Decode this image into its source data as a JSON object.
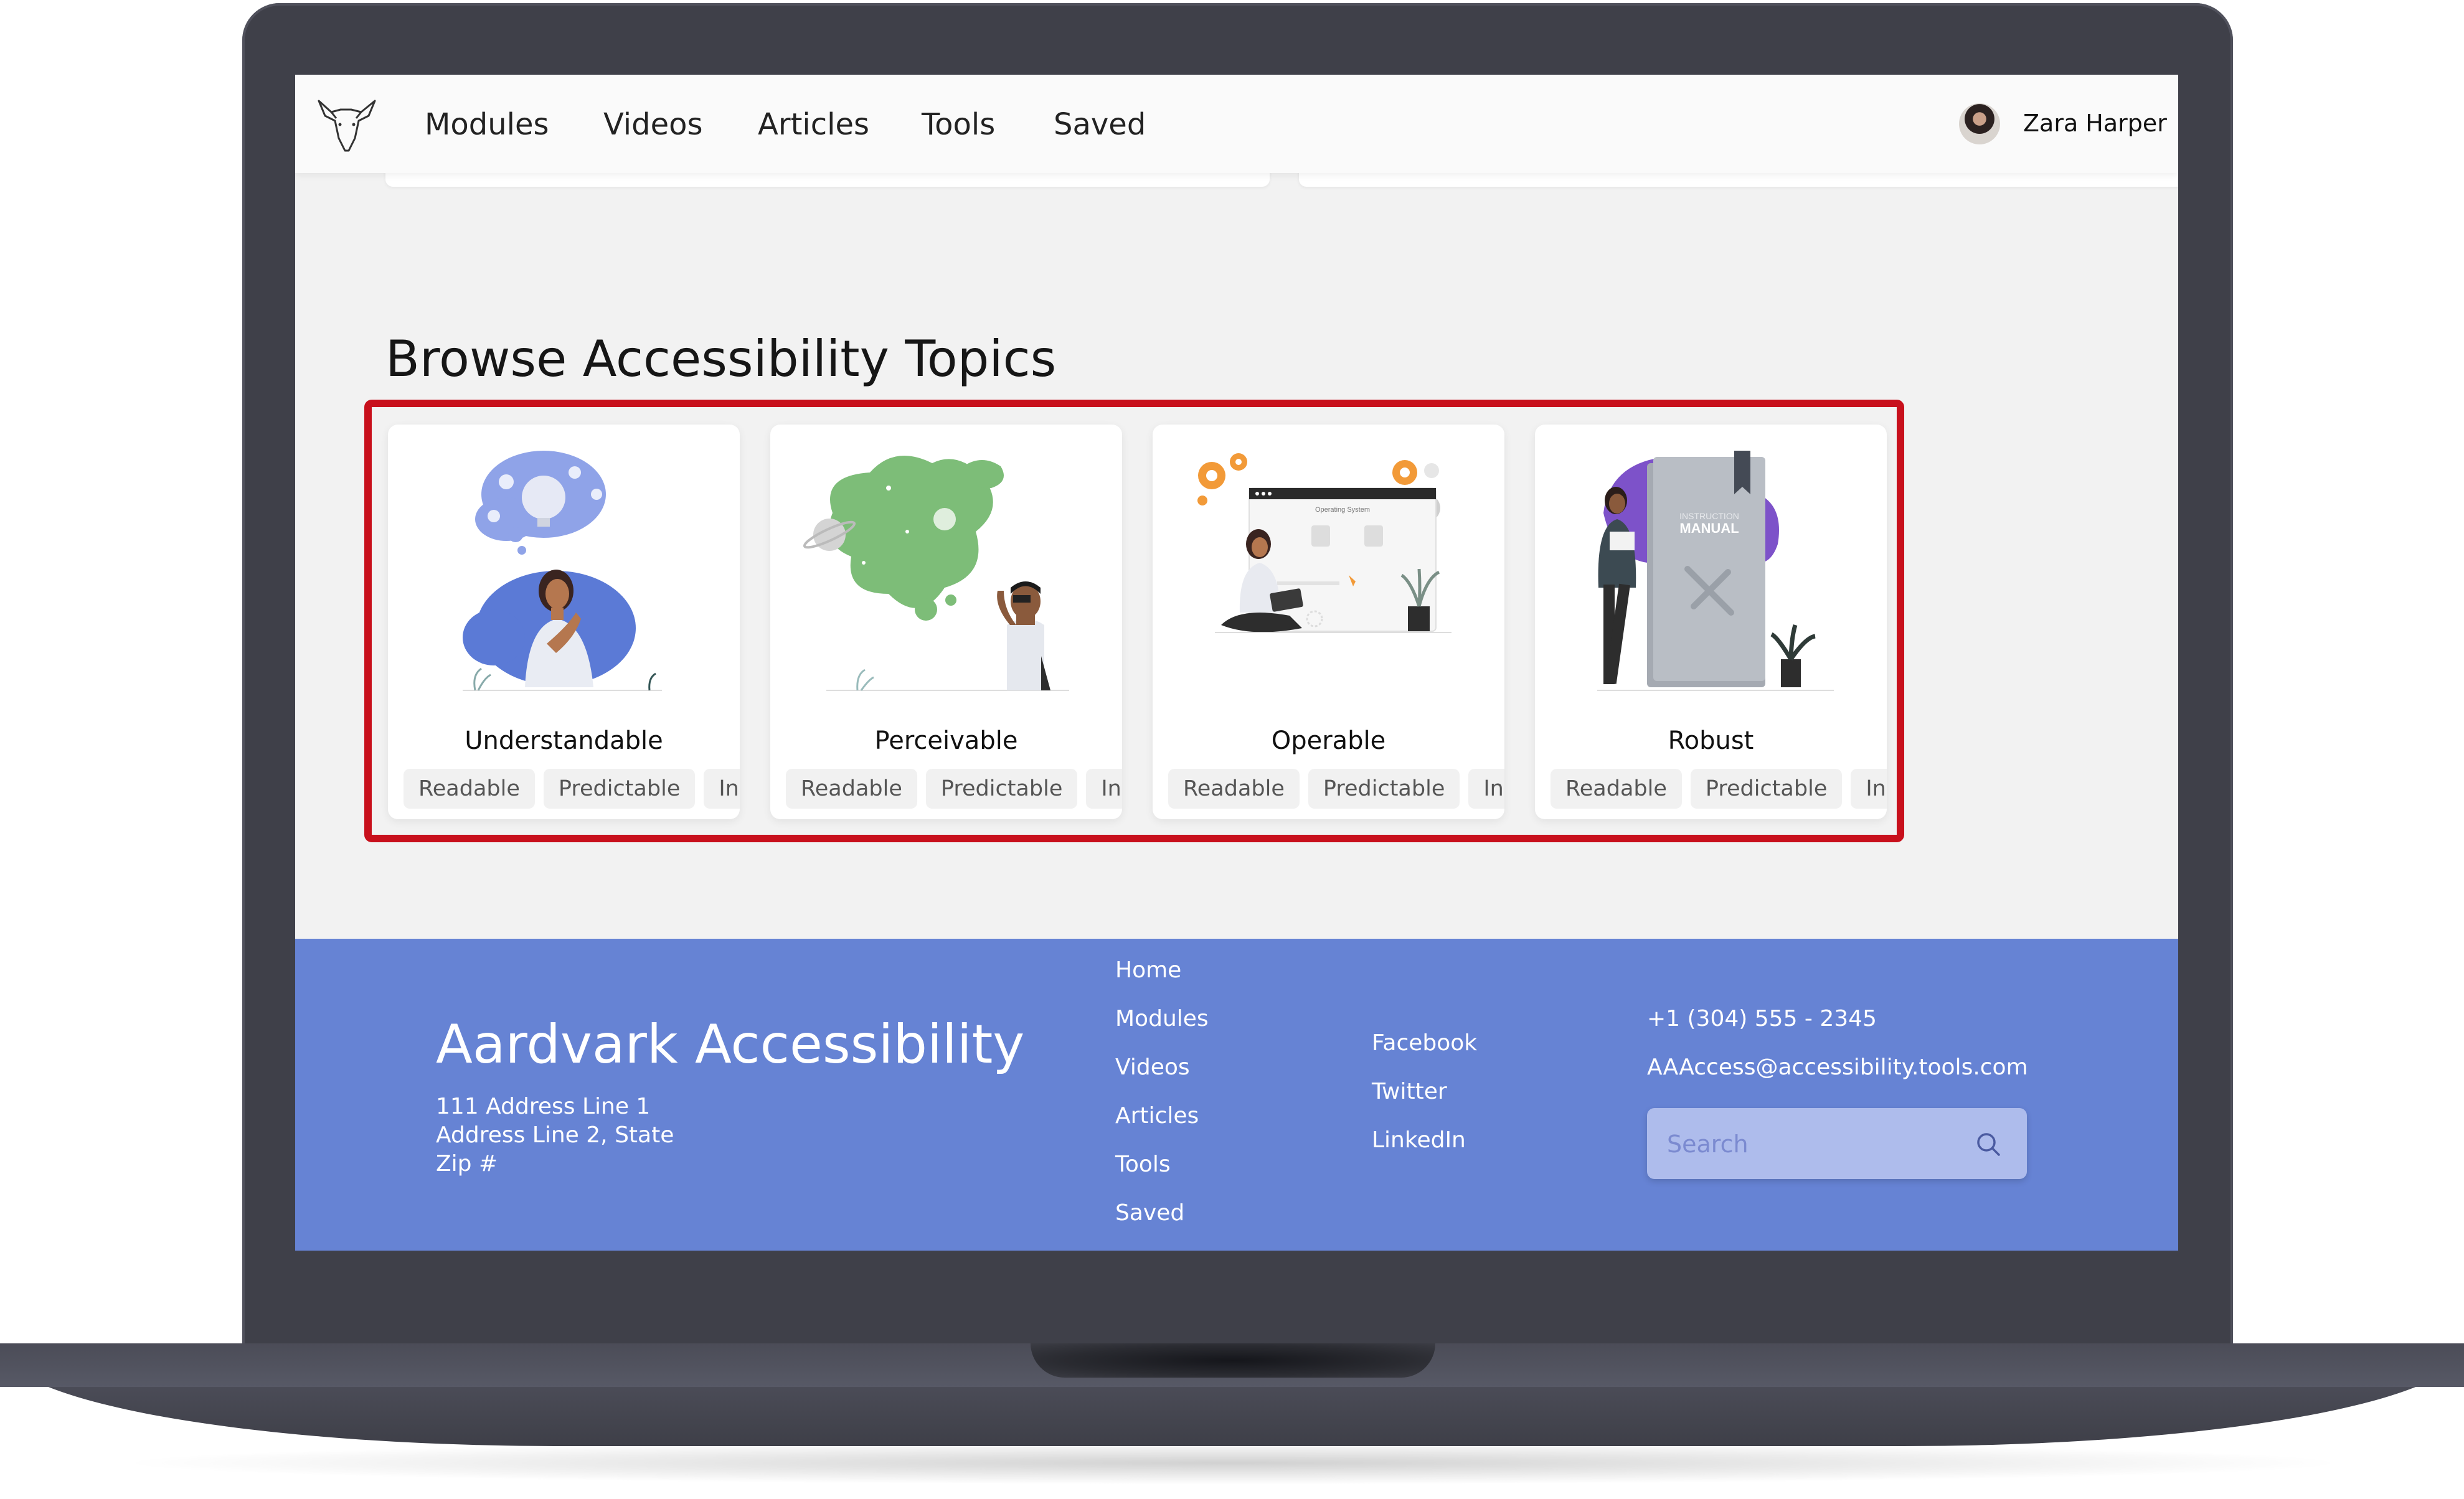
{
  "nav": {
    "items": [
      "Modules",
      "Videos",
      "Articles",
      "Tools",
      "Saved"
    ],
    "user_name": "Zara Harper"
  },
  "section": {
    "title": "Browse Accessibility Topics"
  },
  "topics": [
    {
      "title": "Understandable",
      "tags": [
        "Readable",
        "Predictable",
        "Input Assistance"
      ]
    },
    {
      "title": "Perceivable",
      "tags": [
        "Readable",
        "Predictable",
        "Input Assistance"
      ]
    },
    {
      "title": "Operable",
      "tags": [
        "Readable",
        "Predictable",
        "Input Assistance"
      ]
    },
    {
      "title": "Robust",
      "tags": [
        "Readable",
        "Predictable",
        "Input Assistance"
      ]
    }
  ],
  "robust_illustration_text": [
    "INSTRUCTION",
    "MANUAL"
  ],
  "operable_illustration_text": "Operating System",
  "footer": {
    "brand": "Aardvark Accessibility",
    "address": [
      "111 Address Line 1",
      "Address Line 2, State",
      "Zip #"
    ],
    "site_links": [
      "Home",
      "Modules",
      "Videos",
      "Articles",
      "Tools",
      "Saved"
    ],
    "social_links": [
      "Facebook",
      "Twitter",
      "LinkedIn"
    ],
    "phone": "+1 (304) 555 - 2345",
    "email": "AAAccess@accessibility.tools.com",
    "search_placeholder": "Search"
  },
  "colors": {
    "footer_bg": "#6683d4",
    "highlight": "#c8101c",
    "laptop_frame": "#3f4049",
    "screen_bg": "#f2f2f2"
  }
}
